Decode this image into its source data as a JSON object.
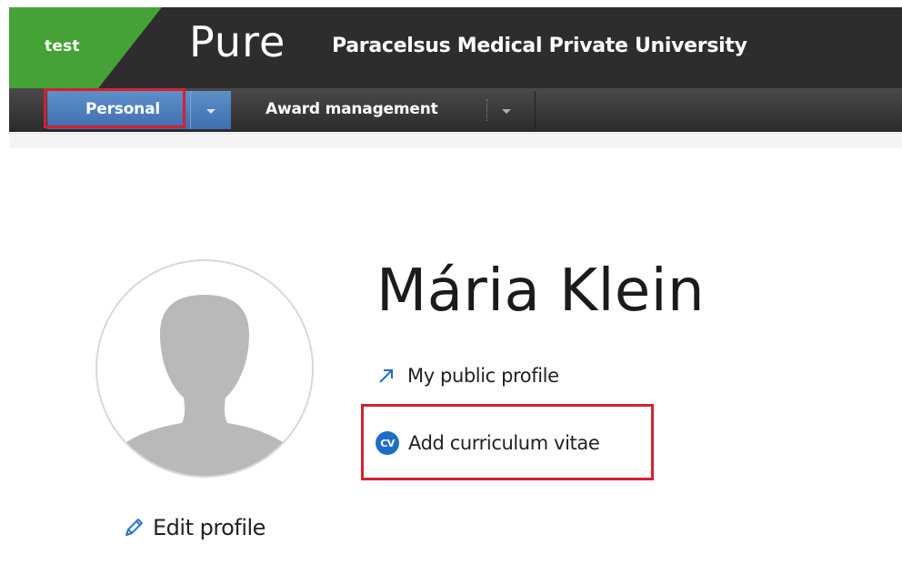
{
  "header": {
    "environment": "test",
    "brand": "Pure",
    "university": "Paracelsus Medical Private University"
  },
  "nav": {
    "tabs": [
      {
        "label": "Personal",
        "active": true
      },
      {
        "label": "Award management",
        "active": false
      }
    ]
  },
  "profile": {
    "name": "Mária Klein",
    "public_profile_label": "My public profile",
    "add_cv_label": "Add curriculum vitae",
    "cv_badge": "CV",
    "edit_profile_label": "Edit profile"
  },
  "icons": {
    "public_profile": "arrow-up-right-icon",
    "add_cv": "cv-icon",
    "edit_profile": "pencil-icon",
    "avatar": "person-silhouette-icon"
  },
  "colors": {
    "header_bg": "#2d2d2d",
    "env_badge": "#45a236",
    "active_tab": "#4f80c0",
    "highlight": "#d6202f",
    "cv_badge": "#1f6ec6",
    "link_icon": "#1f6ec6"
  }
}
